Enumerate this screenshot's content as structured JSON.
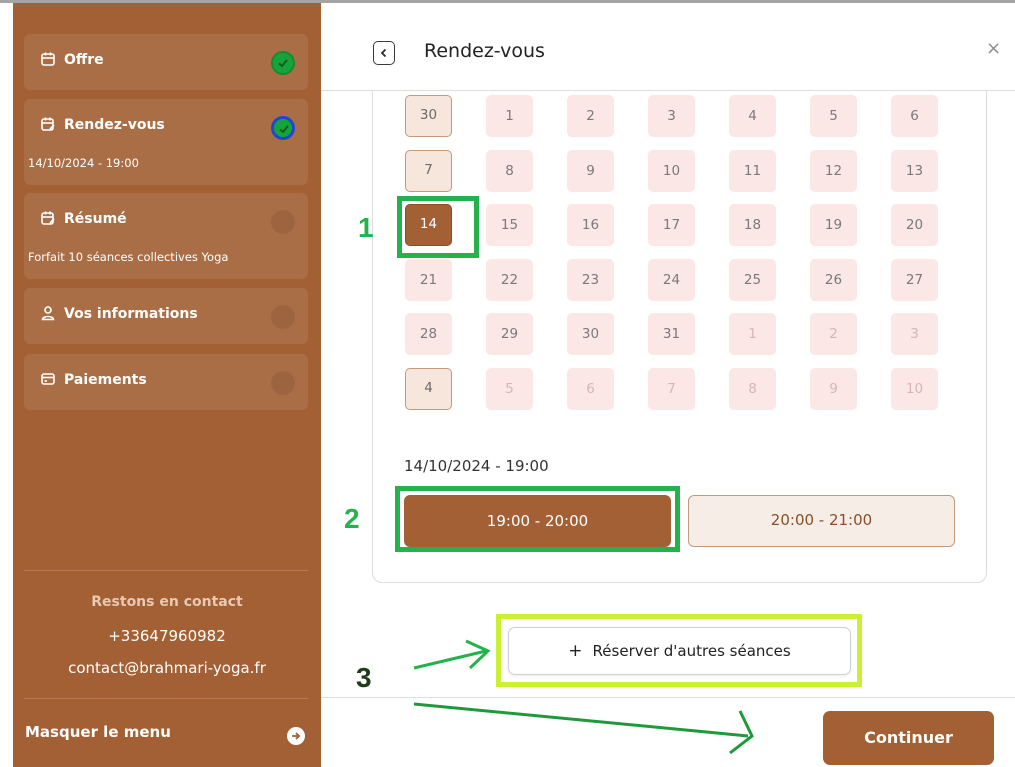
{
  "sidebar": {
    "steps": [
      {
        "title": "Offre",
        "icon": "calendar-icon",
        "status": "done"
      },
      {
        "title": "Rendez-vous",
        "icon": "calendar-edit-icon",
        "subtitle": "14/10/2024 - 19:00",
        "status": "active"
      },
      {
        "title": "Résumé",
        "icon": "calendar-edit-icon",
        "subtitle": "Forfait 10 séances collectives Yoga",
        "status": "pending"
      },
      {
        "title": "Vos informations",
        "icon": "user-icon",
        "status": "pending"
      },
      {
        "title": "Paiements",
        "icon": "card-icon",
        "status": "pending"
      }
    ],
    "contact": {
      "heading": "Restons en contact",
      "phone": "+33647960982",
      "email": "contact@brahmari-yoga.fr"
    },
    "hide_menu": "Masquer le menu"
  },
  "header": {
    "title": "Rendez-vous",
    "close": "×"
  },
  "calendar": {
    "rows": [
      [
        "30",
        "1",
        "2",
        "3",
        "4",
        "5",
        "6"
      ],
      [
        "7",
        "8",
        "9",
        "10",
        "11",
        "12",
        "13"
      ],
      [
        "14",
        "15",
        "16",
        "17",
        "18",
        "19",
        "20"
      ],
      [
        "21",
        "22",
        "23",
        "24",
        "25",
        "26",
        "27"
      ],
      [
        "28",
        "29",
        "30",
        "31",
        "1",
        "2",
        "3"
      ],
      [
        "4",
        "5",
        "6",
        "7",
        "8",
        "9",
        "10"
      ]
    ],
    "selected_date": "14/10/2024 - 19:00"
  },
  "slots": [
    "19:00 - 20:00",
    "20:00 - 21:00"
  ],
  "actions": {
    "book_more": "Réserver d'autres séances",
    "book_more_icon": "+",
    "continue": "Continuer"
  },
  "annotations": [
    "1",
    "2",
    "3"
  ],
  "colors": {
    "brand": "#a26034",
    "annotation_green": "#23b24b",
    "annotation_lime": "#c9f032"
  }
}
